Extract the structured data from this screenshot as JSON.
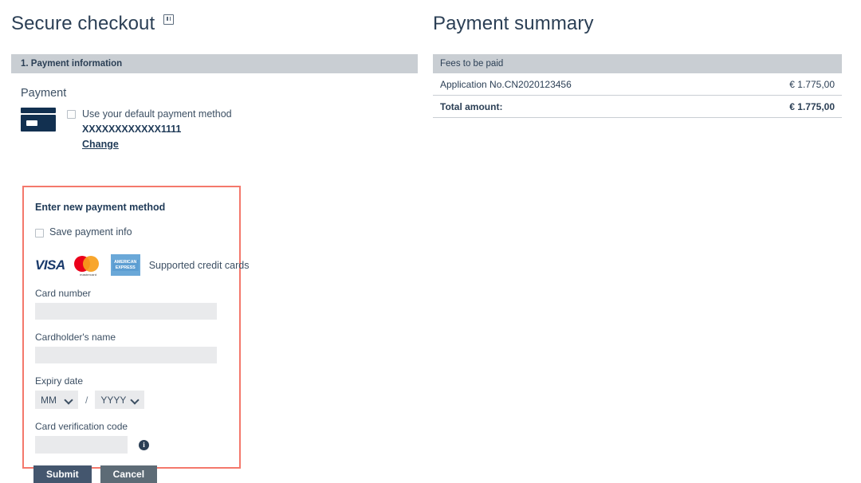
{
  "left": {
    "page_title": "Secure checkout",
    "secure_badge_icon": "lock-icon",
    "section_header": "1. Payment information",
    "payment_label": "Payment",
    "card_icon": "credit-card-icon",
    "default_method_checkbox_label": "Use your default payment method",
    "masked_card_number": "XXXXXXXXXXXX1111",
    "change_link": "Change",
    "new_payment": {
      "title": "Enter new payment method",
      "save_info_label": "Save payment info",
      "brands": {
        "visa": "VISA",
        "mastercard_word": "mastercard",
        "amex_line1": "AMERICAN",
        "amex_line2": "EXPRESS",
        "supported_text": "Supported credit cards"
      },
      "card_number_label": "Card number",
      "card_number_value": "",
      "cardholder_label": "Cardholder's name",
      "cardholder_value": "",
      "expiry_label": "Expiry date",
      "expiry_month": "MM",
      "expiry_separator": "/",
      "expiry_year": "YYYY",
      "cvc_label": "Card verification code",
      "cvc_value": "",
      "cvc_info_icon": "info-icon"
    },
    "submit_button": "Submit",
    "cancel_button": "Cancel"
  },
  "right": {
    "page_title": "Payment summary",
    "table_header": "Fees to be paid",
    "rows": [
      {
        "label": "Application No.CN2020123456",
        "amount": "€ 1.775,00"
      }
    ],
    "total_label": "Total amount:",
    "total_amount": "€ 1.775,00"
  },
  "colors": {
    "header_bar": "#c9ced3",
    "highlight_border": "#f4786c",
    "text_navy": "#2b3f55",
    "input_bg": "#e9eaec",
    "card_navy": "#123050"
  }
}
